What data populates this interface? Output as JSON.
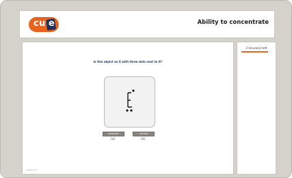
{
  "header": {
    "logo_text": "cut",
    "logo_box_text": "e",
    "title": "Ability to concentrate"
  },
  "sidebar": {
    "timer_text": "2 minute(s) left",
    "timer_progress": 0.88
  },
  "main": {
    "question": "Is this object an E with three dots next to it?",
    "stimulus": "E with dots",
    "buttons": [
      {
        "label": "incorrect",
        "key": "[a]"
      },
      {
        "label": "correct",
        "key": "[d]"
      }
    ],
    "footer": "page 1/1 v2"
  },
  "colors": {
    "frame": "#d5d1cb",
    "accent": "#e8641e",
    "question": "#1f3566",
    "button": "#8c8680"
  }
}
